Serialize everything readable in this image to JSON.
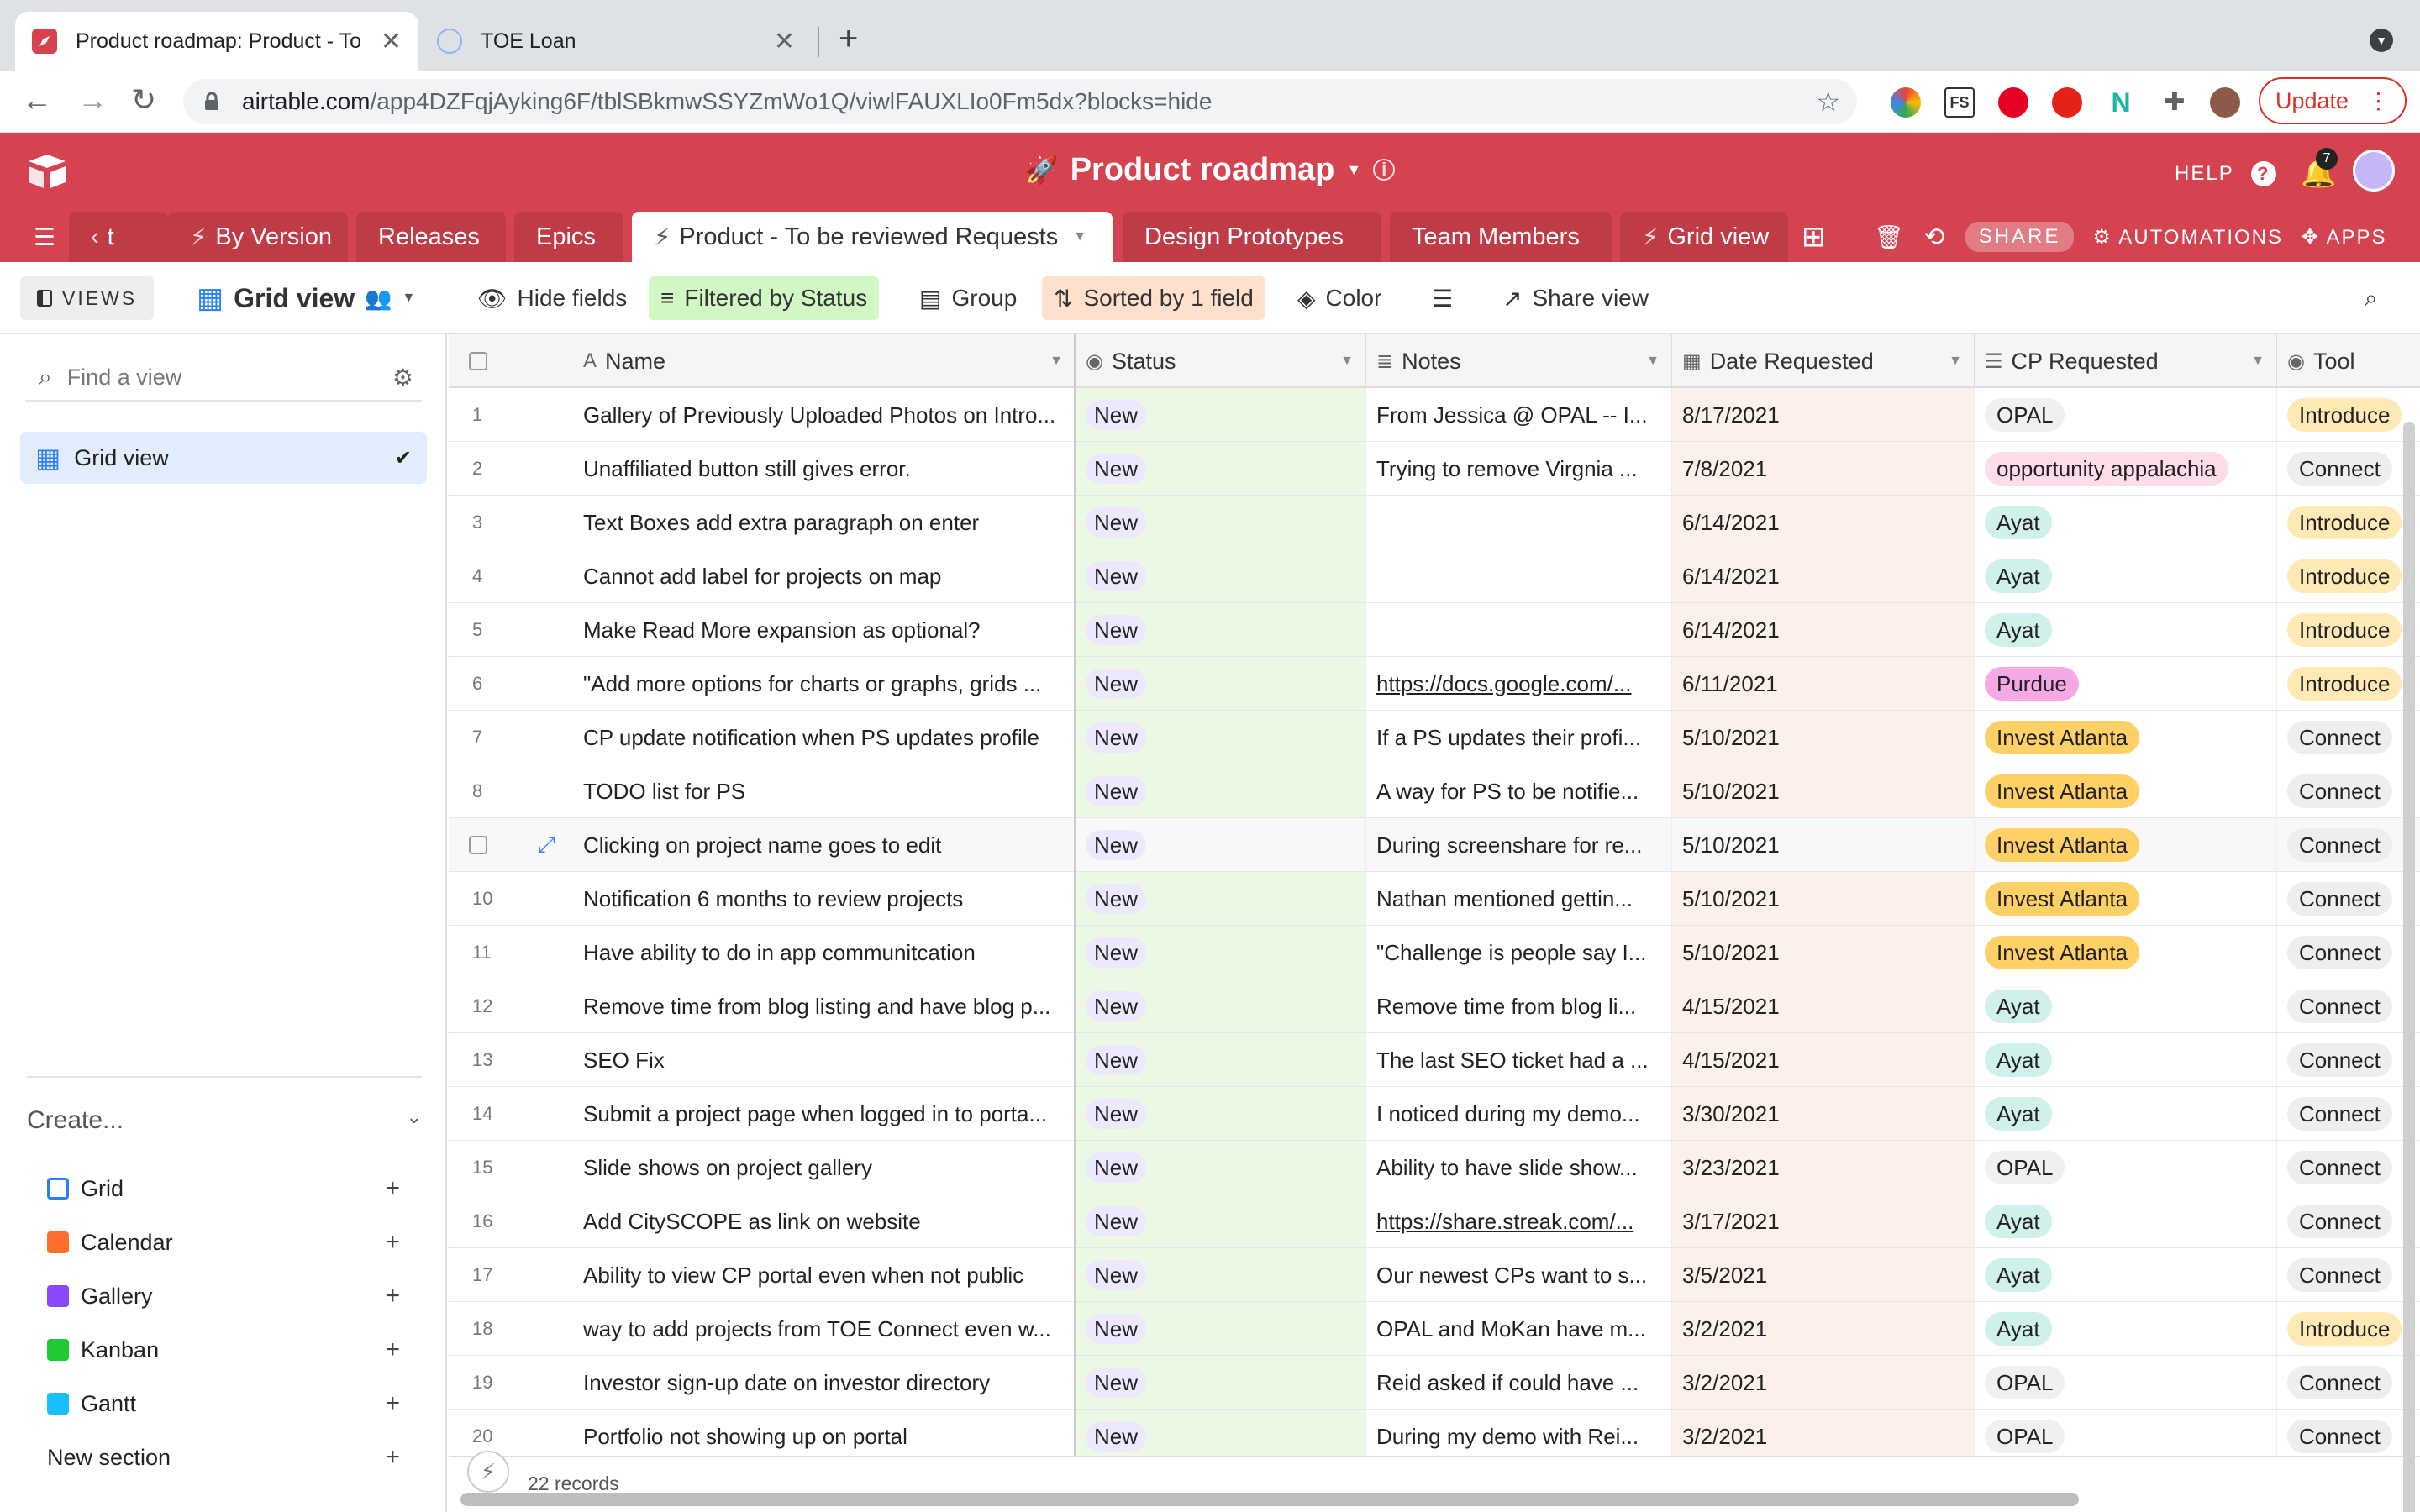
{
  "browser": {
    "tabs": [
      {
        "title": "Product roadmap: Product - To",
        "active": true
      },
      {
        "title": "TOE Loan",
        "active": false
      }
    ],
    "url_host": "airtable.com",
    "url_path": "/app4DZFqjAyking6F/tblSBkmwSSYZmWo1Q/viwlFAUXLIo0Fm5dx?blocks=hide",
    "update_label": "Update"
  },
  "app": {
    "base_title": "Product roadmap",
    "help_label": "HELP",
    "notification_count": "7",
    "colors": {
      "brand": "#d54350",
      "status_bg": "#eaf8e4",
      "date_bg": "#fdf0ea"
    }
  },
  "table_tabs": [
    {
      "label": "t"
    },
    {
      "label": "By Version"
    },
    {
      "label": "Releases"
    },
    {
      "label": "Epics"
    },
    {
      "label": "Product - To be reviewed Requests"
    },
    {
      "label": "Design Prototypes"
    },
    {
      "label": "Team Members"
    },
    {
      "label": "Grid view"
    }
  ],
  "table_actions": {
    "share": "SHARE",
    "automations": "AUTOMATIONS",
    "apps": "APPS"
  },
  "viewbar": {
    "views": "VIEWS",
    "view_name": "Grid view",
    "hide_fields": "Hide fields",
    "filtered": "Filtered by Status",
    "group": "Group",
    "sorted": "Sorted by 1 field",
    "color": "Color",
    "share_view": "Share view"
  },
  "sidebar": {
    "find_placeholder": "Find a view",
    "current_view": "Grid view",
    "create_label": "Create...",
    "create_items": [
      {
        "label": "Grid",
        "color": "#2d7ff9"
      },
      {
        "label": "Calendar",
        "color": "#ff6f2c"
      },
      {
        "label": "Gallery",
        "color": "#8b46ff"
      },
      {
        "label": "Kanban",
        "color": "#20c933"
      },
      {
        "label": "Gantt",
        "color": "#18bfff"
      },
      {
        "label": "New section",
        "color": ""
      }
    ]
  },
  "grid": {
    "columns": [
      "Name",
      "Status",
      "Notes",
      "Date Requested",
      "CP Requested",
      "Tool"
    ],
    "record_count": "22 records",
    "rows": [
      {
        "n": "1",
        "name": "Gallery of Previously Uploaded Photos on Intro...",
        "status": "New",
        "notes": "From Jessica @ OPAL -- I...",
        "date": "8/17/2021",
        "cp": "OPAL",
        "tool": "Introduce"
      },
      {
        "n": "2",
        "name": "Unaffiliated button still gives error.",
        "status": "New",
        "notes": "Trying to remove Virgnia ...",
        "date": "7/8/2021",
        "cp": "opportunity appalachia",
        "tool": "Connect"
      },
      {
        "n": "3",
        "name": "Text Boxes add extra paragraph on enter",
        "status": "New",
        "notes": "",
        "date": "6/14/2021",
        "cp": "Ayat",
        "tool": "Introduce"
      },
      {
        "n": "4",
        "name": "Cannot add label for projects on map",
        "status": "New",
        "notes": "",
        "date": "6/14/2021",
        "cp": "Ayat",
        "tool": "Introduce"
      },
      {
        "n": "5",
        "name": "Make Read More expansion as optional?",
        "status": "New",
        "notes": "",
        "date": "6/14/2021",
        "cp": "Ayat",
        "tool": "Introduce"
      },
      {
        "n": "6",
        "name": "\"Add more options for charts or graphs, grids ...",
        "status": "New",
        "notes": "https://docs.google.com/...",
        "date": "6/11/2021",
        "cp": "Purdue",
        "tool": "Introduce"
      },
      {
        "n": "7",
        "name": "CP update notification when PS updates profile",
        "status": "New",
        "notes": "If a PS updates their profi...",
        "date": "5/10/2021",
        "cp": "Invest Atlanta",
        "tool": "Connect"
      },
      {
        "n": "8",
        "name": "TODO list for PS",
        "status": "New",
        "notes": "A way for PS to be notifie...",
        "date": "5/10/2021",
        "cp": "Invest Atlanta",
        "tool": "Connect"
      },
      {
        "n": "",
        "name": "Clicking on project name goes to edit",
        "status": "New",
        "notes": "During screenshare for re...",
        "date": "5/10/2021",
        "cp": "Invest Atlanta",
        "tool": "Connect"
      },
      {
        "n": "10",
        "name": "Notification 6 months to review projects",
        "status": "New",
        "notes": "Nathan mentioned gettin...",
        "date": "5/10/2021",
        "cp": "Invest Atlanta",
        "tool": "Connect"
      },
      {
        "n": "11",
        "name": "Have ability to do in app communitcation",
        "status": "New",
        "notes": "\"Challenge is people say I...",
        "date": "5/10/2021",
        "cp": "Invest Atlanta",
        "tool": "Connect"
      },
      {
        "n": "12",
        "name": "Remove time from blog listing and have blog p...",
        "status": "New",
        "notes": "Remove time from blog li...",
        "date": "4/15/2021",
        "cp": "Ayat",
        "tool": "Connect"
      },
      {
        "n": "13",
        "name": "SEO Fix",
        "status": "New",
        "notes": "The last SEO ticket had a ...",
        "date": "4/15/2021",
        "cp": "Ayat",
        "tool": "Connect"
      },
      {
        "n": "14",
        "name": "Submit a project page when logged in to porta...",
        "status": "New",
        "notes": "I noticed during my demo...",
        "date": "3/30/2021",
        "cp": "Ayat",
        "tool": "Connect"
      },
      {
        "n": "15",
        "name": "Slide shows on project gallery",
        "status": "New",
        "notes": "Ability to have slide show...",
        "date": "3/23/2021",
        "cp": "OPAL",
        "tool": "Connect"
      },
      {
        "n": "16",
        "name": "Add CitySCOPE as link on website",
        "status": "New",
        "notes": "https://share.streak.com/...",
        "date": "3/17/2021",
        "cp": "Ayat",
        "tool": "Connect"
      },
      {
        "n": "17",
        "name": "Ability to view CP portal even when not public",
        "status": "New",
        "notes": "Our newest CPs want to s...",
        "date": "3/5/2021",
        "cp": "Ayat",
        "tool": "Connect"
      },
      {
        "n": "18",
        "name": "way to add projects from TOE Connect even w...",
        "status": "New",
        "notes": "OPAL and MoKan have m...",
        "date": "3/2/2021",
        "cp": "Ayat",
        "tool": "Introduce"
      },
      {
        "n": "19",
        "name": "Investor sign-up date on investor directory",
        "status": "New",
        "notes": "Reid asked if could have ...",
        "date": "3/2/2021",
        "cp": "OPAL",
        "tool": "Connect"
      },
      {
        "n": "20",
        "name": "Portfolio not showing up on portal",
        "status": "New",
        "notes": "During my demo with Rei...",
        "date": "3/2/2021",
        "cp": "OPAL",
        "tool": "Connect"
      }
    ]
  }
}
